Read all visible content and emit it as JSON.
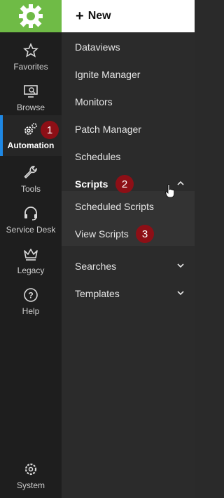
{
  "header": {
    "new_label": "New"
  },
  "rail": {
    "items": [
      {
        "label": "Favorites",
        "icon": "star-icon"
      },
      {
        "label": "Browse",
        "icon": "monitor-search-icon"
      },
      {
        "label": "Automation",
        "icon": "gears-icon",
        "active": true
      },
      {
        "label": "Tools",
        "icon": "wrench-icon"
      },
      {
        "label": "Service Desk",
        "icon": "headset-icon"
      },
      {
        "label": "Legacy",
        "icon": "crown-icon"
      },
      {
        "label": "Help",
        "icon": "help-circle-icon"
      }
    ],
    "system_label": "System"
  },
  "menu": {
    "items": [
      {
        "label": "Dataviews"
      },
      {
        "label": "Ignite Manager"
      },
      {
        "label": "Monitors"
      },
      {
        "label": "Patch Manager"
      },
      {
        "label": "Schedules"
      },
      {
        "label": "Scripts",
        "expanded": true
      },
      {
        "label": "Scheduled Scripts"
      },
      {
        "label": "View Scripts"
      },
      {
        "label": "Searches",
        "expanded": false
      },
      {
        "label": "Templates",
        "expanded": false
      }
    ]
  },
  "badges": {
    "one": "1",
    "two": "2",
    "three": "3"
  },
  "colors": {
    "brand_green": "#6fbb46",
    "active_accent": "#1e88e5",
    "badge_red": "#8d0f16"
  }
}
